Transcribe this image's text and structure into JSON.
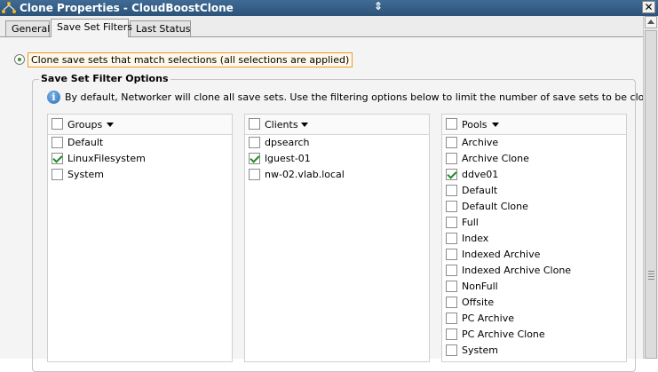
{
  "window": {
    "title": "Clone Properties - CloudBoostClone",
    "close_glyph": "✕"
  },
  "tabs": [
    {
      "label": "General",
      "active": false
    },
    {
      "label": "Save Set Filters",
      "active": true
    },
    {
      "label": "Last Status",
      "active": false
    }
  ],
  "radio": {
    "label": "Clone save sets that match selections (all selections are applied)",
    "selected": true
  },
  "filter_options": {
    "title": "Save Set Filter Options",
    "info_glyph": "i",
    "info_text": "By default, Networker will clone all save sets. Use the filtering options below to limit the number of save sets to be cloned."
  },
  "lists": {
    "groups": {
      "header": "Groups",
      "items": [
        {
          "label": "Default",
          "checked": false
        },
        {
          "label": "LinuxFilesystem",
          "checked": true
        },
        {
          "label": "System",
          "checked": false
        }
      ]
    },
    "clients": {
      "header": "Clients",
      "items": [
        {
          "label": "dpsearch",
          "checked": false
        },
        {
          "label": "lguest-01",
          "checked": true
        },
        {
          "label": "nw-02.vlab.local",
          "checked": false
        }
      ]
    },
    "pools": {
      "header": "Pools",
      "items": [
        {
          "label": "Archive",
          "checked": false
        },
        {
          "label": "Archive Clone",
          "checked": false
        },
        {
          "label": "ddve01",
          "checked": true
        },
        {
          "label": "Default",
          "checked": false
        },
        {
          "label": "Default Clone",
          "checked": false
        },
        {
          "label": "Full",
          "checked": false
        },
        {
          "label": "Index",
          "checked": false
        },
        {
          "label": "Indexed Archive",
          "checked": false
        },
        {
          "label": "Indexed Archive Clone",
          "checked": false
        },
        {
          "label": "NonFull",
          "checked": false
        },
        {
          "label": "Offsite",
          "checked": false
        },
        {
          "label": "PC Archive",
          "checked": false
        },
        {
          "label": "PC Archive Clone",
          "checked": false
        },
        {
          "label": "System",
          "checked": false
        }
      ]
    }
  },
  "icons": {
    "title": "network-clone-icon",
    "close": "close-icon",
    "info": "info-icon",
    "caret": "chevron-down-icon"
  },
  "colors": {
    "titlebar": "#2c5379",
    "accent_check": "#1f8a1f",
    "focus_border": "#e89b2a",
    "info_blue": "#2b6cb5"
  }
}
